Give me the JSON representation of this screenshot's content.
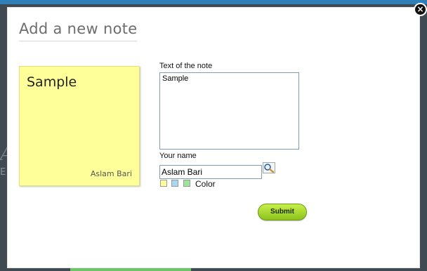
{
  "dialog": {
    "title": "Add a new note",
    "close_label": "×"
  },
  "preview": {
    "text": "Sample",
    "author": "Aslam Bari",
    "color": "#ffff99"
  },
  "form": {
    "text_label": "Text of the note",
    "text_value": "Sample",
    "name_label": "Your name",
    "name_value": "Aslam Bari",
    "color_label": "Color",
    "colors": [
      "#ffff99",
      "#a8d8f0",
      "#9ee59a"
    ],
    "search_icon": "magnifier-icon",
    "submit_label": "Submit"
  },
  "background": {
    "faint_letter": "A",
    "faint_letter_2": "E"
  }
}
